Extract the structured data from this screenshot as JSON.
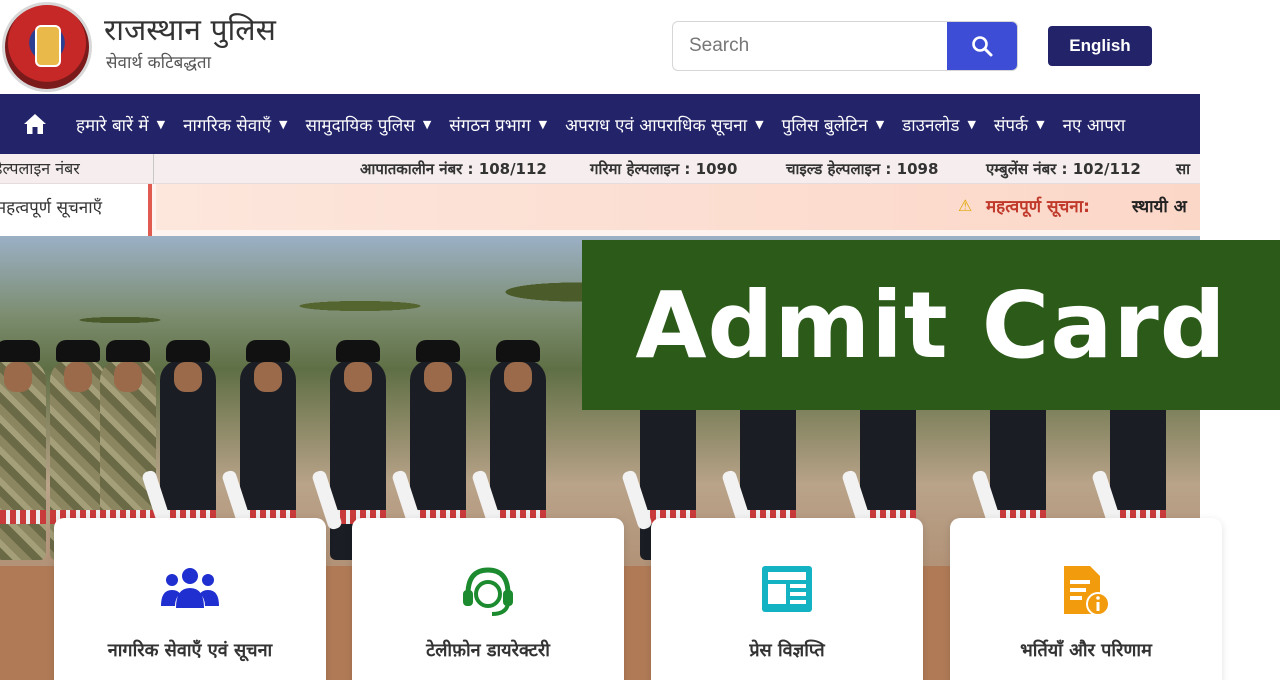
{
  "header": {
    "site_title": "राजस्थान पुलिस",
    "tagline": "सेवार्थ कटिबद्धता",
    "search_placeholder": "Search",
    "language_button": "English"
  },
  "nav": {
    "items": [
      {
        "label": "हमारे बारें में"
      },
      {
        "label": "नागरिक सेवाएँ"
      },
      {
        "label": "सामुदायिक पुलिस"
      },
      {
        "label": "संगठन प्रभाग"
      },
      {
        "label": "अपराध एवं आपराधिक सूचना"
      },
      {
        "label": "पुलिस बुलेटिन"
      },
      {
        "label": "डाउनलोड"
      },
      {
        "label": "संपर्क"
      },
      {
        "label": "नए आपरा"
      }
    ]
  },
  "helpline": {
    "label": "हेल्पलाइन नंबर",
    "items": [
      "आपातकालीन नंबर : 108/112",
      "गरिमा हेल्पलाइन : 1090",
      "चाइल्ड हेल्पलाइन : 1098",
      "एम्बुलेंस नंबर : 102/112",
      "सा"
    ]
  },
  "notices": {
    "label": "महत्वपूर्ण सूचनाएँ",
    "heading": "महत्वपूर्ण सूचना:",
    "text": "स्थायी अ"
  },
  "hero": {
    "overlay_text": "Admit Card"
  },
  "cards": [
    {
      "label": "नागरिक सेवाएँ एवं सूचना",
      "icon": "users-group-icon",
      "color": "#1f2fd0"
    },
    {
      "label": "टेलीफ़ोन डायरेक्टरी",
      "icon": "headset-support-icon",
      "color": "#1c8a2e"
    },
    {
      "label": "प्रेस विज्ञप्ति",
      "icon": "newspaper-icon",
      "color": "#14b3c4"
    },
    {
      "label": "भर्तियाँ और परिणाम",
      "icon": "document-info-icon",
      "color": "#f29b0c"
    }
  ],
  "colors": {
    "nav_bg": "#23236a",
    "search_button": "#3d4dd6",
    "admit_box": "#2b5a19",
    "notice_accent": "#e05a4f"
  }
}
